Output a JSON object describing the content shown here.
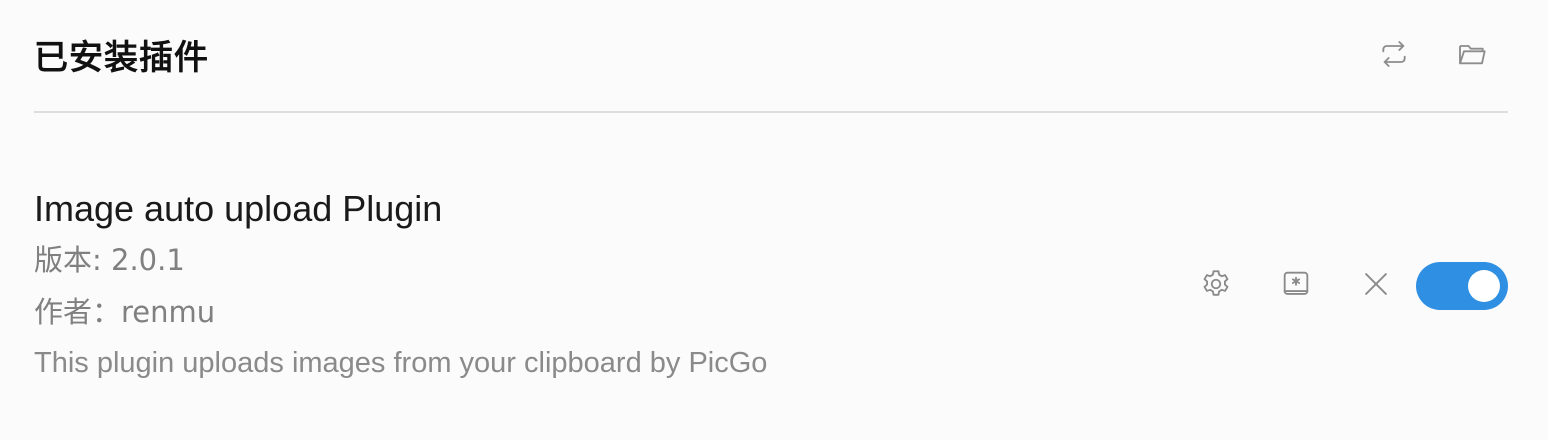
{
  "header": {
    "title": "已安装插件",
    "actions": [
      {
        "name": "refresh",
        "icon": "sync-arrows-icon"
      },
      {
        "name": "open-folder",
        "icon": "folder-icon"
      }
    ]
  },
  "plugin": {
    "name": "Image auto upload Plugin",
    "version_label": "版本: 2.0.1",
    "author_label": "作者：renmu",
    "description": "This plugin uploads images from your clipboard by PicGo",
    "enabled": true,
    "actions": [
      {
        "name": "settings",
        "icon": "gear-icon"
      },
      {
        "name": "hotkeys",
        "icon": "hotkey-icon"
      },
      {
        "name": "uninstall",
        "icon": "close-icon"
      }
    ]
  },
  "colors": {
    "background": "#fbfbfb",
    "toggle_on": "#2f8fe3",
    "divider": "#dedede",
    "muted_text": "#808080",
    "icon": "#8a8a8a"
  }
}
